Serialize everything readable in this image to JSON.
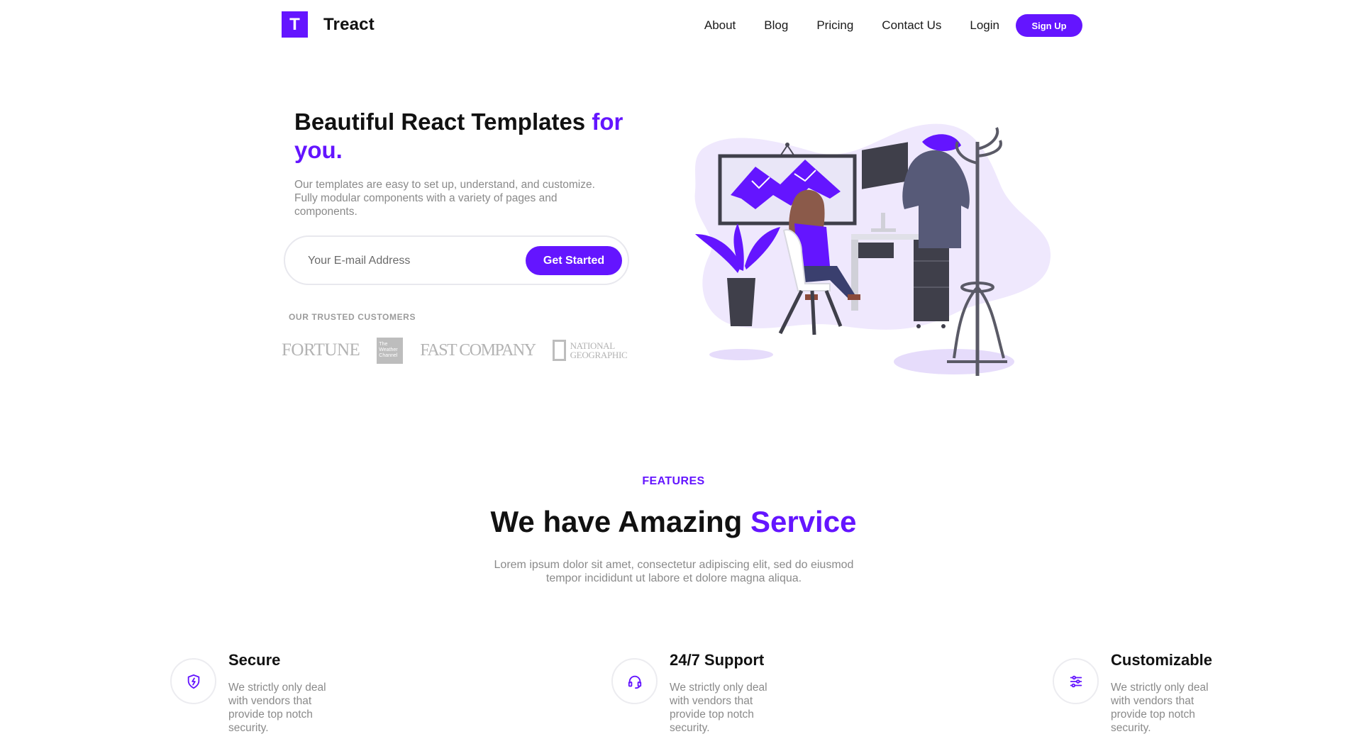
{
  "brand": {
    "logo_letter": "T",
    "name": "Treact",
    "accent_color": "#6415ff"
  },
  "nav": {
    "items": [
      {
        "label": "About"
      },
      {
        "label": "Blog"
      },
      {
        "label": "Pricing"
      },
      {
        "label": "Contact Us"
      },
      {
        "label": "Login"
      }
    ],
    "signup_label": "Sign Up"
  },
  "hero": {
    "title_main": "Beautiful React Templates ",
    "title_accent": "for you.",
    "description": "Our templates are easy to set up, understand, and customize. Fully modular components with a variety of pages and components.",
    "email_placeholder": "Your E-mail Address",
    "cta_label": "Get Started",
    "customers_label": "OUR TRUSTED CUSTOMERS",
    "customers": {
      "fortune": "FORTUNE",
      "weather": "The Weather Channel",
      "fastcompany": "FAST COMPANY",
      "natgeo_line1": "NATIONAL",
      "natgeo_line2": "GEOGRAPHIC"
    }
  },
  "features": {
    "label": "FEATURES",
    "title_main": "We have Amazing ",
    "title_accent": "Service",
    "description": "Lorem ipsum dolor sit amet, consectetur adipiscing elit, sed do eiusmod tempor incididunt ut labore et dolore magna aliqua.",
    "cards": [
      {
        "icon": "shield-icon",
        "title": "Secure",
        "description": "We strictly only deal with vendors that provide top notch security."
      },
      {
        "icon": "headset-icon",
        "title": "24/7 Support",
        "description": "We strictly only deal with vendors that provide top notch security."
      },
      {
        "icon": "sliders-icon",
        "title": "Customizable",
        "description": "We strictly only deal with vendors that provide top notch security."
      }
    ]
  }
}
